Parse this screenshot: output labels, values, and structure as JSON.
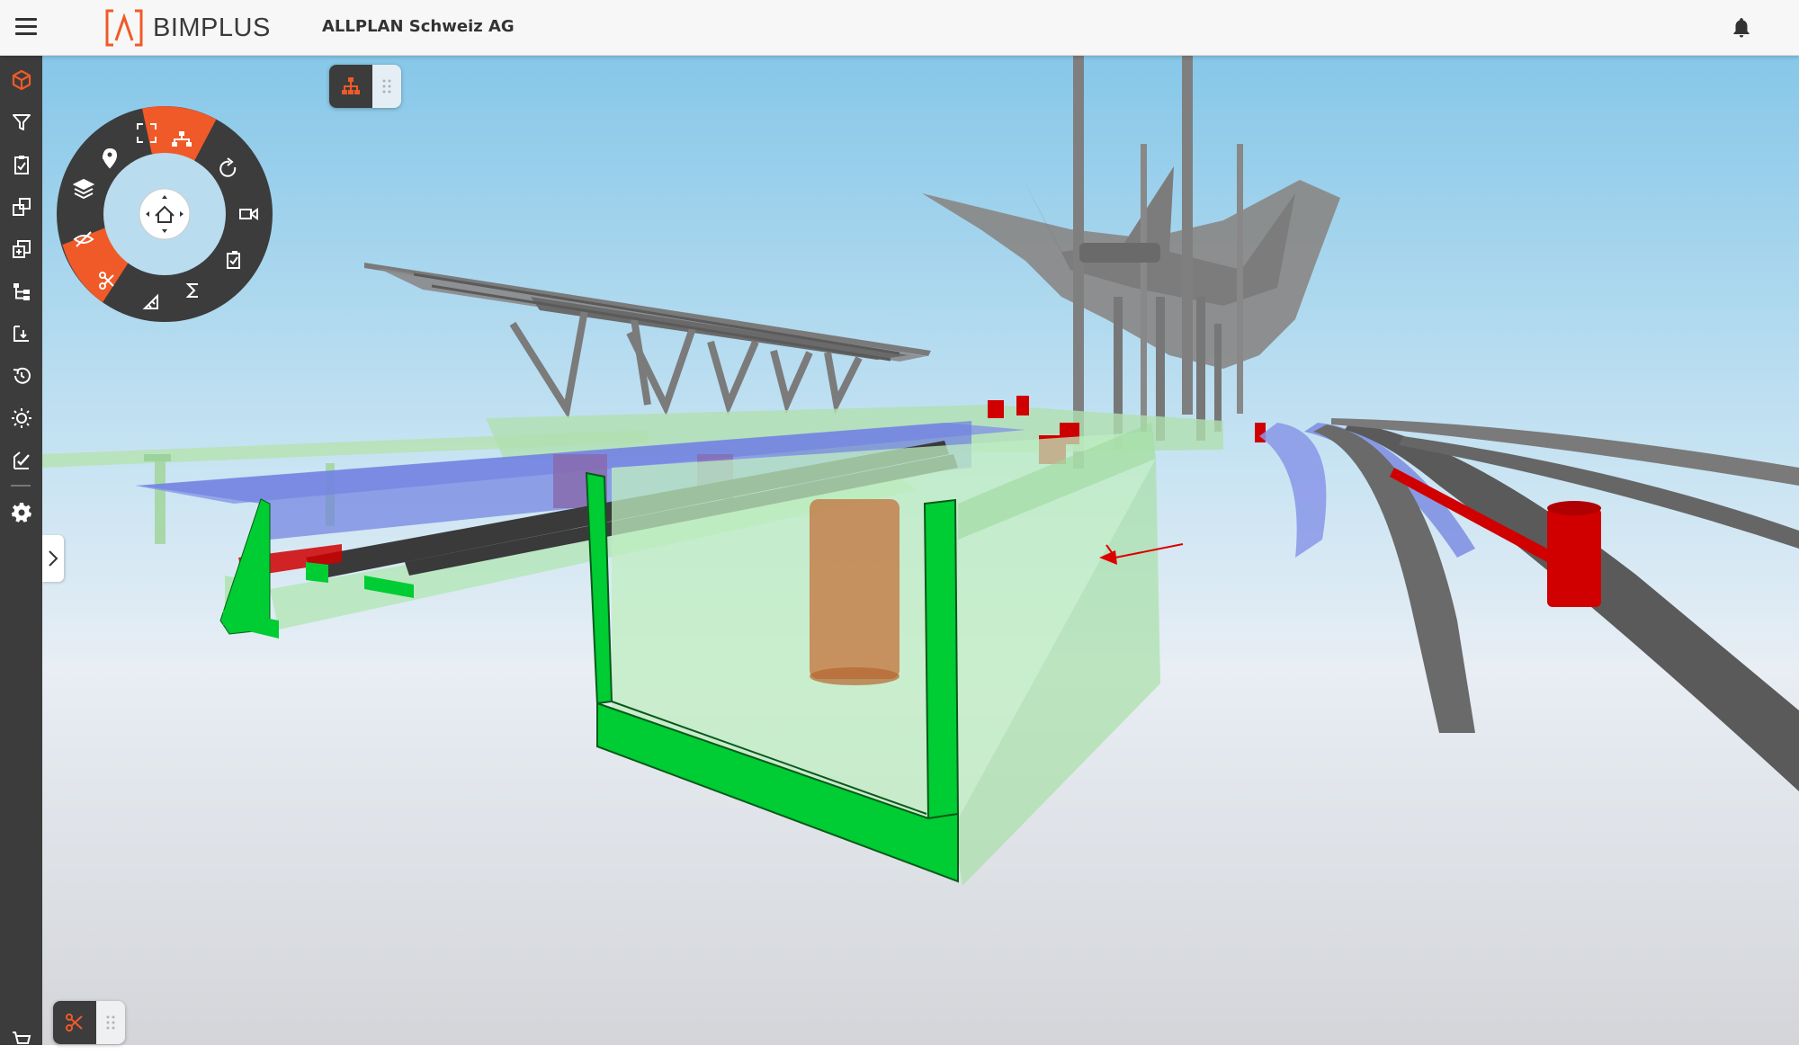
{
  "header": {
    "app_name": "BIMPLUS",
    "company": "ALLPLAN Schweiz AG"
  },
  "colors": {
    "accent": "#f05a28",
    "sidebar_bg": "#3c3c3c",
    "sky_top": "#8ecbe9",
    "sky_bottom": "#ececf2",
    "green_structure": "#00cc33",
    "transparent_green": "#a8e6a8",
    "transparent_blue": "#6f7fe0",
    "steel_gray": "#808080",
    "red_objects": "#d00000"
  },
  "sidebar": {
    "items": [
      {
        "icon": "cube-icon",
        "active": true
      },
      {
        "icon": "filter-icon"
      },
      {
        "icon": "clipboard-icon"
      },
      {
        "icon": "compare-icon"
      },
      {
        "icon": "copy-icon"
      },
      {
        "icon": "hierarchy-icon"
      },
      {
        "icon": "sort-icon"
      },
      {
        "icon": "history-icon"
      },
      {
        "icon": "brightness-icon"
      },
      {
        "icon": "approve-icon"
      },
      {
        "icon": "settings-icon"
      },
      {
        "icon": "cart-icon"
      }
    ]
  },
  "radial_menu": {
    "center": "home-icon",
    "items": [
      {
        "icon": "fit-view-icon"
      },
      {
        "icon": "structure-icon",
        "active": true
      },
      {
        "icon": "rotate-icon"
      },
      {
        "icon": "video-camera-icon"
      },
      {
        "icon": "checklist-icon"
      },
      {
        "icon": "sum-icon"
      },
      {
        "icon": "measure-icon"
      },
      {
        "icon": "section-cut-icon",
        "active": true
      },
      {
        "icon": "hide-icon"
      },
      {
        "icon": "layers-icon"
      },
      {
        "icon": "location-pin-icon"
      }
    ]
  },
  "toolbars": {
    "top": {
      "icon": "structure-icon"
    },
    "bottom": {
      "icon": "section-cut-icon"
    }
  }
}
